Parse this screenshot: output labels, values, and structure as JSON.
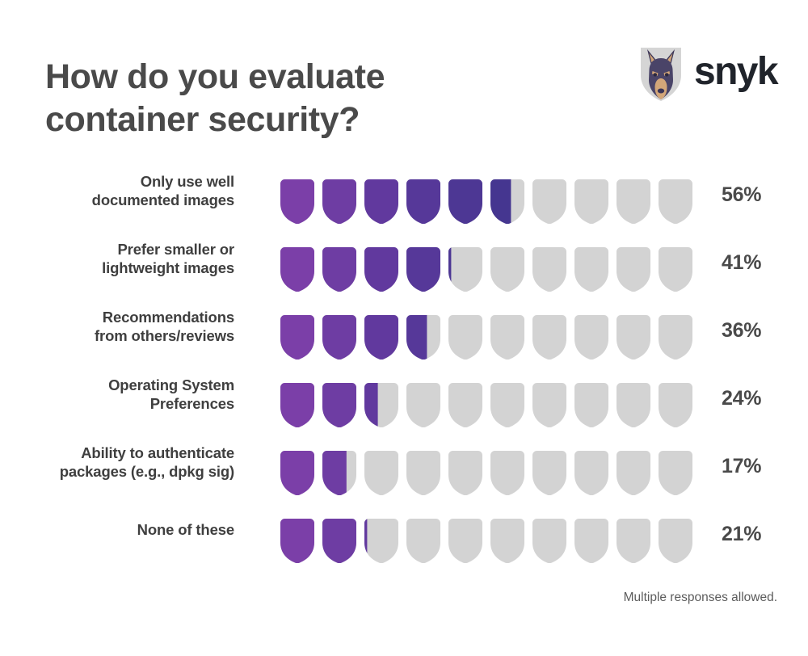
{
  "header": {
    "title_line_1": "How do you evaluate",
    "title_line_2": "container security?"
  },
  "logo": {
    "wordmark": "snyk",
    "mark_name": "snyk-doberman-shield-logo",
    "colors": {
      "shield_bg": "#d5d5d5",
      "dog_dark": "#3b3556",
      "dog_mid": "#4a4468",
      "dog_tan": "#d3a679",
      "wordmark": "#20242b"
    }
  },
  "footnote": {
    "text": "Multiple responses allowed."
  },
  "chart_data": {
    "type": "bar",
    "title": "How do you evaluate container security?",
    "subtitle": "",
    "xlabel": "",
    "ylabel": "",
    "note": "Multiple responses allowed.",
    "units": "percent",
    "icon_unit": "shield",
    "icons_per_row": 10,
    "percent_per_icon": 10,
    "xlim": [
      0,
      100
    ],
    "grid": false,
    "legend": null,
    "categories": [
      "Only use well documented images",
      "Prefer smaller or lightweight images",
      "Recommendations from others/reviews",
      "Operating System Preferences",
      "Ability to authenticate packages (e.g., dpkg sig)",
      "None of these"
    ],
    "values": [
      56,
      41,
      36,
      24,
      17,
      21
    ],
    "value_labels": [
      "56%",
      "41%",
      "36%",
      "24%",
      "17%",
      "21%"
    ],
    "rows": [
      {
        "label_lines": [
          "Only use well",
          "documented images"
        ],
        "value": 56,
        "value_label": "56%"
      },
      {
        "label_lines": [
          "Prefer smaller or",
          "lightweight images"
        ],
        "value": 41,
        "value_label": "41%"
      },
      {
        "label_lines": [
          "Recommendations",
          "from others/reviews"
        ],
        "value": 36,
        "value_label": "36%"
      },
      {
        "label_lines": [
          "Operating System",
          "Preferences"
        ],
        "value": 24,
        "value_label": "24%"
      },
      {
        "label_lines": [
          "Ability to authenticate",
          "packages (e.g., dpkg sig)"
        ],
        "value": 17,
        "value_label": "17%"
      },
      {
        "label_lines": [
          "None of these"
        ],
        "value": 21,
        "value_label": "21%"
      }
    ],
    "colors": {
      "empty_shield": "#d3d3d3",
      "filled_gradient": [
        "#7b3fa8",
        "#6e3da3",
        "#61399e",
        "#563899",
        "#4d3794",
        "#453690",
        "#3f358d",
        "#3a348a",
        "#363387",
        "#333284"
      ],
      "label_text": "#3f3f3f",
      "value_text": "#4a4a4a",
      "title_text": "#4a4a4a",
      "background": "#ffffff"
    }
  }
}
